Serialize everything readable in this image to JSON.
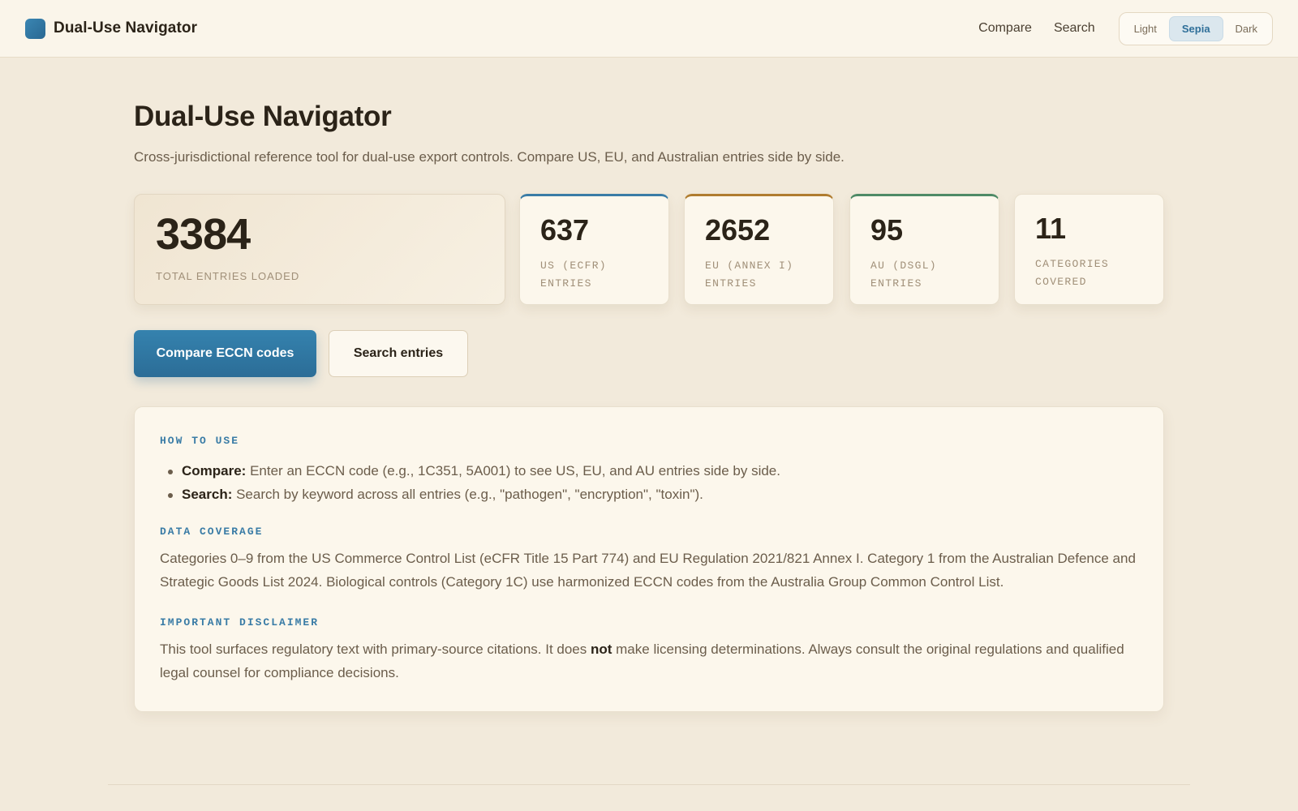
{
  "header": {
    "brand": "Dual-Use Navigator",
    "nav": [
      "Compare",
      "Search"
    ],
    "themes": [
      "Light",
      "Sepia",
      "Dark"
    ],
    "active_theme": "Sepia"
  },
  "page": {
    "title": "Dual-Use Navigator",
    "subtitle": "Cross-jurisdictional reference tool for dual-use export controls. Compare US, EU, and Australian entries side by side."
  },
  "stats": {
    "total": {
      "value": "3384",
      "label": "TOTAL ENTRIES LOADED"
    },
    "us": {
      "value": "637",
      "label_1": "US (ECFR)",
      "label_2": "ENTRIES"
    },
    "eu": {
      "value": "2652",
      "label_1": "EU (ANNEX I)",
      "label_2": "ENTRIES"
    },
    "au": {
      "value": "95",
      "label_1": "AU (DSGL)",
      "label_2": "ENTRIES"
    },
    "categories": {
      "value": "11",
      "label_1": "CATEGORIES",
      "label_2": "COVERED"
    }
  },
  "actions": {
    "compare_label": "Compare ECCN codes",
    "search_label": "Search entries"
  },
  "info": {
    "how_to_title": "HOW TO USE",
    "compare_term": "Compare:",
    "compare_text": " Enter an ECCN code (e.g., 1C351, 5A001) to see US, EU, and AU entries side by side.",
    "search_term": "Search:",
    "search_text": " Search by keyword across all entries (e.g., \"pathogen\", \"encryption\", \"toxin\").",
    "coverage_title": "DATA COVERAGE",
    "coverage_text": "Categories 0–9 from the US Commerce Control List (eCFR Title 15 Part 774) and EU Regulation 2021/821 Annex I. Category 1 from the Australian Defence and Strategic Goods List 2024. Biological controls (Category 1C) use harmonized ECCN codes from the Australia Group Common Control List.",
    "disclaimer_title": "IMPORTANT DISCLAIMER",
    "disclaimer_before": "This tool surfaces regulatory text with primary-source citations. It does ",
    "disclaimer_emphasis": "not",
    "disclaimer_after": " make licensing determinations. Always consult the original regulations and qualified legal counsel for compliance decisions."
  },
  "colors": {
    "accent": "#3a7ca6",
    "eu": "#b07c2f",
    "au": "#4e8a66",
    "background": "#f2eadb"
  }
}
